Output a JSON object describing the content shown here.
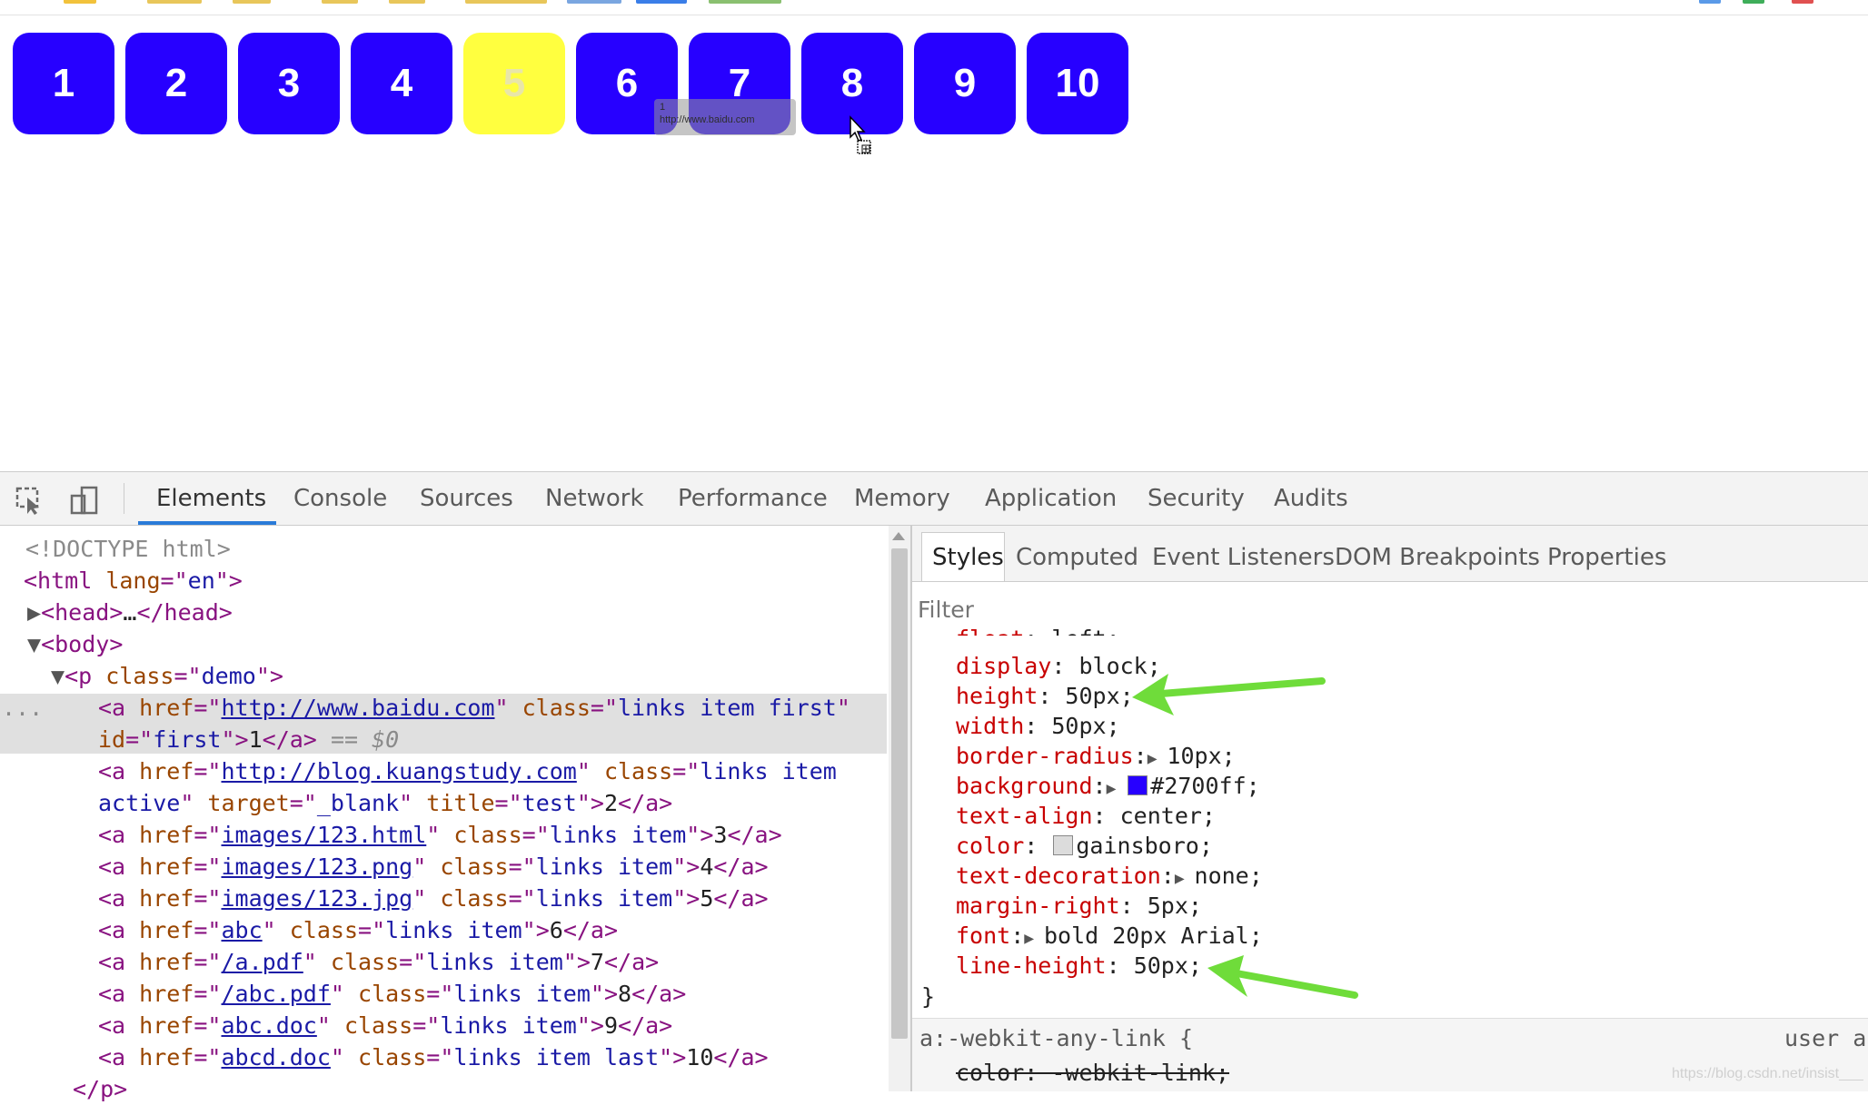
{
  "page": {
    "boxes": [
      {
        "label": "1",
        "href": "http://www.baidu.com",
        "highlight": false
      },
      {
        "label": "2",
        "href": "http://blog.kuangstudy.com",
        "highlight": false
      },
      {
        "label": "3",
        "href": "images/123.html",
        "highlight": false
      },
      {
        "label": "4",
        "href": "images/123.png",
        "highlight": false
      },
      {
        "label": "5",
        "href": "images/123.jpg",
        "highlight": true
      },
      {
        "label": "6",
        "href": "abc",
        "highlight": false
      },
      {
        "label": "7",
        "href": "/a.pdf",
        "highlight": false
      },
      {
        "label": "8",
        "href": "/abc.pdf",
        "highlight": false
      },
      {
        "label": "9",
        "href": "abc.doc",
        "highlight": false
      },
      {
        "label": "10",
        "href": "abcd.doc",
        "highlight": false
      }
    ],
    "drag_tooltip": {
      "line1": "1",
      "line2": "http://www.baidu.com"
    },
    "colors": {
      "box": "#2700ff",
      "box_hover": "#ffff3f"
    }
  },
  "devtools": {
    "tabs": [
      "Elements",
      "Console",
      "Sources",
      "Network",
      "Performance",
      "Memory",
      "Application",
      "Security",
      "Audits"
    ],
    "active_tab": "Elements",
    "elements": {
      "doctype": "<!DOCTYPE html>",
      "html_lang": "en",
      "p_class": "demo",
      "selected_marker": "...",
      "selected_suffix": "== $0",
      "links": [
        {
          "href": "http://www.baidu.com",
          "class": "links item first",
          "id": "first",
          "text": "1"
        },
        {
          "href": "http://blog.kuangstudy.com",
          "class": "links item active",
          "target": "_blank",
          "title": "test",
          "text": "2"
        },
        {
          "href": "images/123.html",
          "class": "links item",
          "text": "3"
        },
        {
          "href": "images/123.png",
          "class": "links item",
          "text": "4"
        },
        {
          "href": "images/123.jpg",
          "class": "links item",
          "text": "5"
        },
        {
          "href": "abc",
          "class": "links item",
          "text": "6"
        },
        {
          "href": "/a.pdf",
          "class": "links item",
          "text": "7"
        },
        {
          "href": "/abc.pdf",
          "class": "links item",
          "text": "8"
        },
        {
          "href": "abc.doc",
          "class": "links item",
          "text": "9"
        },
        {
          "href": "abcd.doc",
          "class": "links item last",
          "text": "10"
        }
      ]
    },
    "styles_tabs": [
      "Styles",
      "Computed",
      "Event Listeners",
      "DOM Breakpoints",
      "Properties"
    ],
    "active_styles_tab": "Styles",
    "filter_placeholder": "Filter",
    "css_rules": [
      {
        "name": "float",
        "value": "left;",
        "partial": true
      },
      {
        "name": "display",
        "value": "block;"
      },
      {
        "name": "height",
        "value": "50px;",
        "arrow": true
      },
      {
        "name": "width",
        "value": "50px;"
      },
      {
        "name": "border-radius",
        "value": "10px;",
        "expand": true
      },
      {
        "name": "background",
        "value": "#2700ff;",
        "expand": true,
        "swatch": "#2700ff"
      },
      {
        "name": "text-align",
        "value": "center;"
      },
      {
        "name": "color",
        "value": "gainsboro;",
        "swatch": "#dcdcdc"
      },
      {
        "name": "text-decoration",
        "value": "none;",
        "expand": true
      },
      {
        "name": "margin-right",
        "value": "5px;"
      },
      {
        "name": "font",
        "value": "bold 20px Arial;",
        "expand": true
      },
      {
        "name": "line-height",
        "value": "50px;",
        "arrow": true
      }
    ],
    "rule_close": "}",
    "ua_rule": {
      "selector": "a:-webkit-any-link {",
      "source": "user a",
      "struck_decl": "color: -webkit-link;"
    },
    "annotation_color": "#6fdc3a"
  },
  "watermark": "https://blog.csdn.net/insist___"
}
